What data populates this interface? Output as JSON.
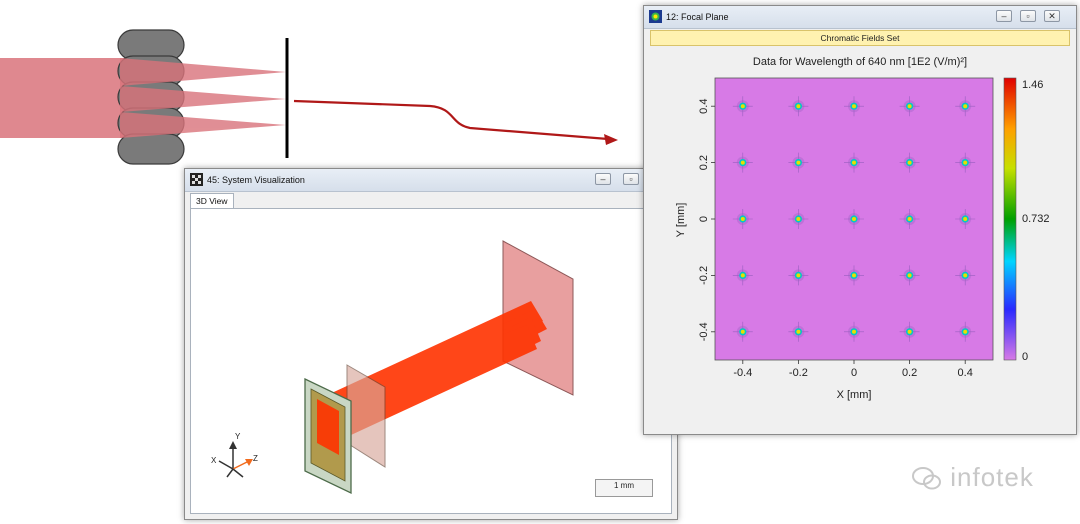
{
  "vis_window": {
    "title": "45: System Visualization",
    "tab_label": "3D View",
    "scale_label": "1 mm",
    "axes": {
      "x": "X",
      "y": "Y",
      "z": "Z"
    }
  },
  "focal_window": {
    "title": "12: Focal Plane",
    "header_bar": "Chromatic Fields Set",
    "plot_title": "Data for Wavelength of 640 nm  [1E2 (V/m)²]",
    "xlabel": "X [mm]",
    "ylabel": "Y [mm]",
    "x_ticks": [
      "-0.4",
      "-0.2",
      "0",
      "0.2",
      "0.4"
    ],
    "y_ticks": [
      "0.4",
      "0.2",
      "0",
      "-0.2",
      "-0.4"
    ],
    "colorbar_ticks": [
      "1.46",
      "0.732",
      "0"
    ]
  },
  "watermark": "infotek",
  "colors": {
    "plot_bg": "#d77ae6",
    "beam": "#ff3300",
    "arrow": "#b01818",
    "fields_bar": "#fff2b0"
  },
  "chart_data": {
    "type": "heatmap",
    "title": "Data for Wavelength of 640 nm  [1E2 (V/m)²]",
    "xlabel": "X [mm]",
    "ylabel": "Y [mm]",
    "x_grid": [
      -0.4,
      -0.2,
      0,
      0.2,
      0.4
    ],
    "y_grid": [
      -0.4,
      -0.2,
      0,
      0.2,
      0.4
    ],
    "spot_peak_value": 1.46,
    "background_value": 0,
    "colorbar_range": [
      0,
      1.46
    ],
    "xlim": [
      -0.5,
      0.5
    ],
    "ylim": [
      -0.5,
      0.5
    ]
  }
}
